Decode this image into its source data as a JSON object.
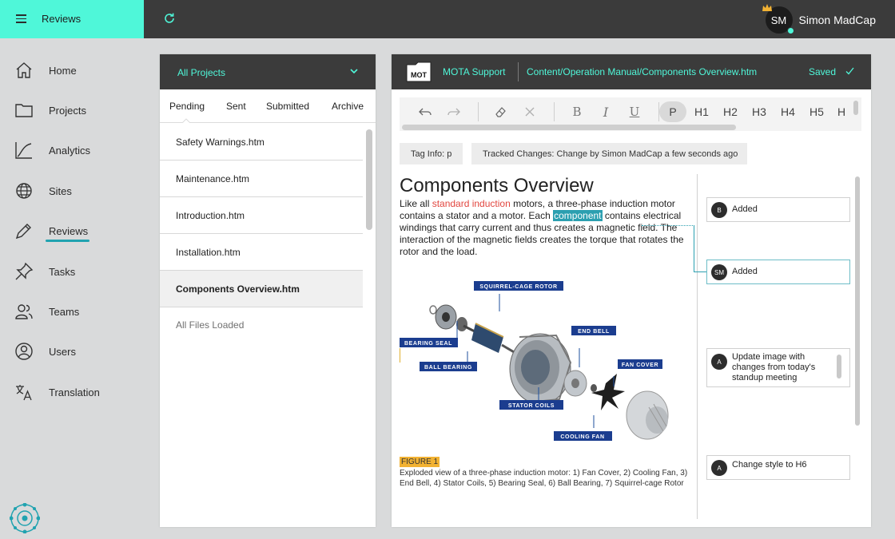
{
  "app": {
    "title": "Reviews",
    "colors": {
      "accent": "#4ff7d9",
      "dark": "#3b3b3b",
      "highlight": "#2b9fb0",
      "insert_red": "#e2463f",
      "figure_label": "#f2b233"
    }
  },
  "header": {
    "refresh_icon": "refresh-icon",
    "user": {
      "initials": "SM",
      "name": "Simon MadCap"
    }
  },
  "nav": {
    "items": [
      {
        "label": "Home",
        "icon": "home-icon"
      },
      {
        "label": "Projects",
        "icon": "folder-icon"
      },
      {
        "label": "Analytics",
        "icon": "analytics-icon"
      },
      {
        "label": "Sites",
        "icon": "globe-icon"
      },
      {
        "label": "Reviews",
        "icon": "pen-icon",
        "active": true
      },
      {
        "label": "Tasks",
        "icon": "pin-icon"
      },
      {
        "label": "Teams",
        "icon": "team-icon"
      },
      {
        "label": "Users",
        "icon": "user-icon"
      },
      {
        "label": "Translation",
        "icon": "translate-icon"
      }
    ]
  },
  "files": {
    "project": "All Projects",
    "tabs": [
      "Pending",
      "Sent",
      "Submitted",
      "Archive"
    ],
    "active_tab": "Pending",
    "list": [
      "Safety Warnings.htm",
      "Maintenance.htm",
      "Introduction.htm",
      "Installation.htm",
      "Components Overview.htm"
    ],
    "active_file": "Components Overview.htm",
    "footer": "All Files Loaded"
  },
  "editor": {
    "badge": "MOT",
    "project": "MOTA Support",
    "path": "Content/Operation Manual/Components Overview.htm",
    "status": "Saved",
    "toolbar": {
      "undo_icon": "undo-icon",
      "redo_icon": "redo-icon",
      "eraser_icon": "eraser-icon",
      "clear_icon": "close-icon",
      "bold": "B",
      "italic": "I",
      "underline": "U",
      "p": "P",
      "h1": "H1",
      "h2": "H2",
      "h3": "H3",
      "h4": "H4",
      "h5": "H5",
      "h6": "H"
    },
    "tag_info": "Tag Info: p",
    "tracked_changes": "Tracked Changes:  Change by Simon MadCap a few seconds ago",
    "doc": {
      "title": "Components Overview",
      "p1_a": "Like all ",
      "p1_ins": "standard induction",
      "p1_b": " motors, a three-phase induction motor contains a stator and a motor. Each ",
      "p1_hl": "component",
      "p1_c": " contains electrical windings that carry current and thus creates a magnetic field. The interaction of the magnetic fields creates the torque that rotates the rotor and the load.",
      "figure_label": "FIGURE 1",
      "caption": "Exploded view of a three-phase induction motor: 1) Fan Cover, 2) Cooling Fan, 3) End Bell, 4) Stator Coils, 5) Bearing Seal, 6) Ball Bearing, 7) Squirrel-cage Rotor",
      "callouts": {
        "rotor": "SQUIRREL-CAGE ROTOR",
        "seal": "BEARING SEAL",
        "bearing": "BALL BEARING",
        "bell": "END BELL",
        "fancover": "FAN COVER",
        "stator": "STATOR COILS",
        "fan": "COOLING FAN"
      }
    },
    "comments": [
      {
        "initials": "B",
        "text": "Added"
      },
      {
        "initials": "SM",
        "text": "Added"
      },
      {
        "initials": "A",
        "text": "Update image with changes from today's standup meeting"
      },
      {
        "initials": "A",
        "text": "Change style to H6"
      }
    ]
  }
}
